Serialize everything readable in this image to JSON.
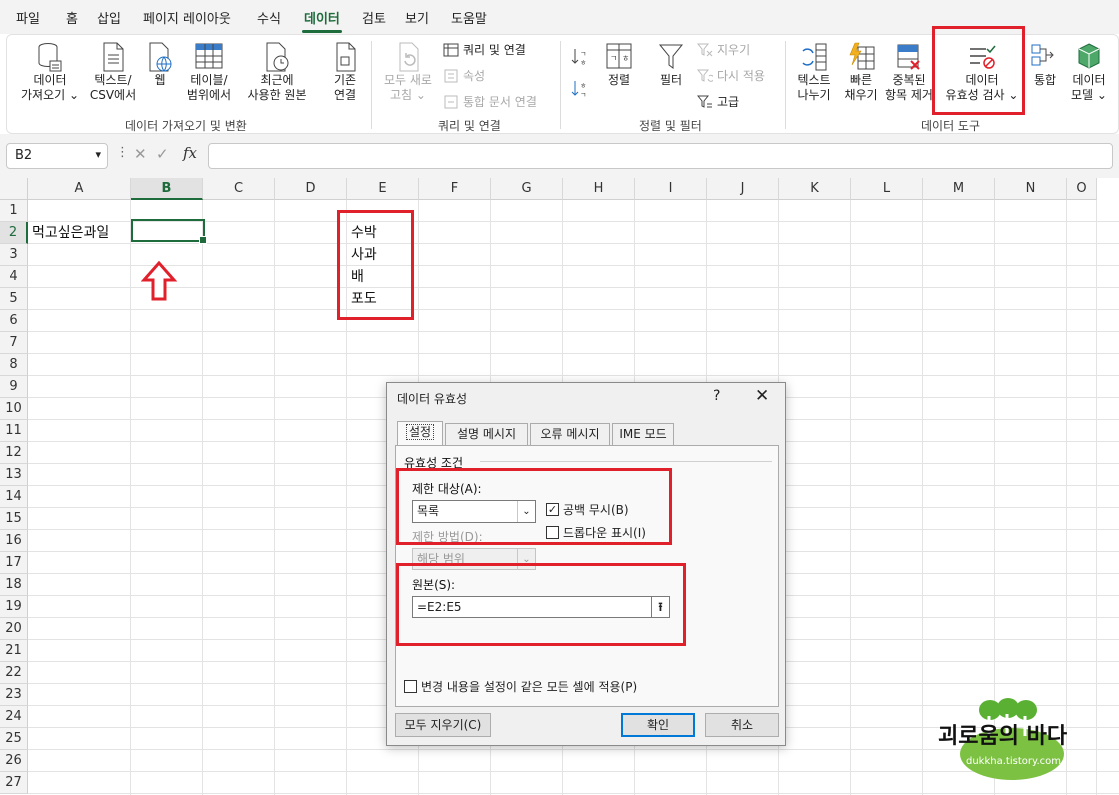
{
  "menu": {
    "tabs": [
      "파일",
      "홈",
      "삽입",
      "페이지 레이아웃",
      "수식",
      "데이터",
      "검토",
      "보기",
      "도움말"
    ],
    "active_index": 5
  },
  "ribbon": {
    "get_data": {
      "line1": "데이터",
      "line2": "가져오기 ⌄"
    },
    "text_csv": {
      "line1": "텍스트/",
      "line2": "CSV에서"
    },
    "web": {
      "line1": "웹"
    },
    "table_range": {
      "line1": "테이블/",
      "line2": "범위에서"
    },
    "recent_sources": {
      "line1": "최근에",
      "line2": "사용한 원본"
    },
    "existing": {
      "line1": "기존",
      "line2": "연결"
    },
    "group1": "데이터 가져오기 및 변환",
    "refresh_all": {
      "line1": "모두 새로",
      "line2": "고침 ⌄"
    },
    "queries_connections": "쿼리 및 연결",
    "properties": "속성",
    "edit_links": "통합 문서 연결",
    "group2": "쿼리 및 연결",
    "sort_az": "",
    "sort": "정렬",
    "filter": "필터",
    "clear": "지우기",
    "reapply": "다시 적용",
    "advanced": "고급",
    "group3": "정렬 및 필터",
    "text_to_columns": {
      "line1": "텍스트",
      "line2": "나누기"
    },
    "flash_fill": {
      "line1": "빠른",
      "line2": "채우기"
    },
    "remove_duplicates": {
      "line1": "중복된",
      "line2": "항목 제거"
    },
    "data_validation": {
      "line1": "데이터",
      "line2": "유효성 검사 ⌄"
    },
    "consolidate": {
      "line1": "통합"
    },
    "data_model": {
      "line1": "데이터",
      "line2": "모델 ⌄"
    },
    "group4": "데이터 도구"
  },
  "formula_bar": {
    "name_box": "B2",
    "formula": "",
    "fx": "fx"
  },
  "sheet": {
    "columns": [
      "A",
      "B",
      "C",
      "D",
      "E",
      "F",
      "G",
      "H",
      "I",
      "J",
      "K",
      "L",
      "M",
      "N",
      "O"
    ],
    "rows": [
      "1",
      "2",
      "3",
      "4",
      "5",
      "6",
      "7",
      "8",
      "9",
      "10",
      "11",
      "12",
      "13",
      "14",
      "15",
      "16",
      "17",
      "18",
      "19",
      "20",
      "21",
      "22",
      "23",
      "24",
      "25",
      "26",
      "27"
    ],
    "selected_cell": "B2",
    "a2": "먹고싶은과일",
    "e_values": [
      "수박",
      "사과",
      "배",
      "포도"
    ]
  },
  "dialog": {
    "title": "데이터 유효성",
    "help": "?",
    "close": "✕",
    "tabs": [
      "설정",
      "설명 메시지",
      "오류 메시지",
      "IME 모드"
    ],
    "active_tab": 0,
    "section_title": "유효성 조건",
    "allow_label": "제한 대상(A):",
    "allow_value": "목록",
    "ignore_blank": "공백 무시(B)",
    "ignore_blank_checked": true,
    "dropdown": "드롭다운 표시(I)",
    "dropdown_checked": false,
    "data_label": "제한 방법(D):",
    "data_value": "해당 범위",
    "source_label": "원본(S):",
    "source_value": "=E2:E5",
    "apply_all": "변경 내용을 설정이 같은 모든 셀에 적용(P)",
    "clear_all": "모두 지우기(C)",
    "ok": "확인",
    "cancel": "취소"
  },
  "watermark": {
    "title": "괴로움의 바다",
    "url": "dukkha.tistory.com"
  },
  "colors": {
    "accent": "#1e6b3c",
    "highlight": "#e0202a"
  }
}
